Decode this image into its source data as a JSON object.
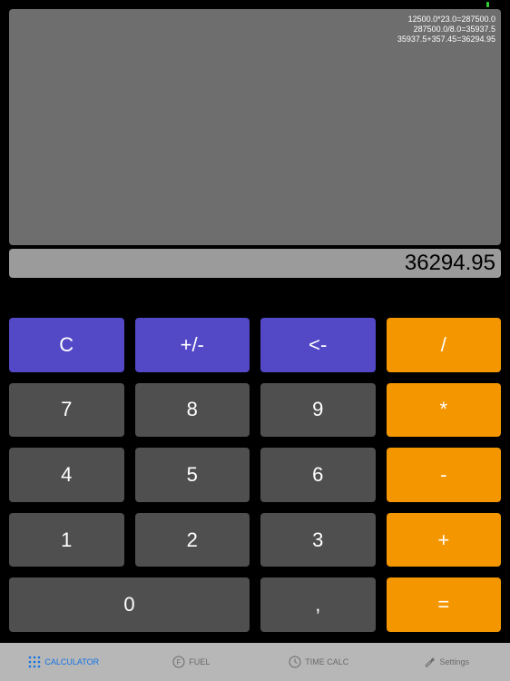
{
  "history": [
    "12500.0*23.0=287500.0",
    "287500.0/8.0=35937.5",
    "35937.5+357.45=36294.95"
  ],
  "display": "36294.95",
  "keys": {
    "clear": "C",
    "sign": "+/-",
    "back": "<-",
    "divide": "/",
    "seven": "7",
    "eight": "8",
    "nine": "9",
    "multiply": "*",
    "four": "4",
    "five": "5",
    "six": "6",
    "minus": "-",
    "one": "1",
    "two": "2",
    "three": "3",
    "plus": "+",
    "zero": "0",
    "comma": ",",
    "equals": "="
  },
  "tabs": {
    "calculator": "CALCULATOR",
    "fuel": "FUEL",
    "timecalc": "TIME CALC",
    "settings": "Settings"
  },
  "colors": {
    "fn": "#5348c6",
    "num": "#4f4f4f",
    "op": "#f49600",
    "tab_active": "#1273e6"
  }
}
